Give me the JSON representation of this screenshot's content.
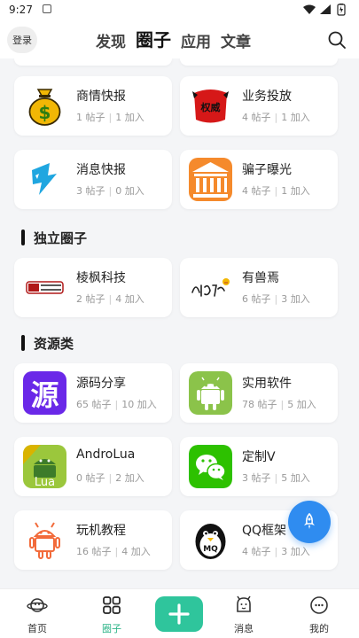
{
  "status_bar": {
    "time": "9:27"
  },
  "header": {
    "login_label": "登录",
    "tabs": [
      {
        "label": "发现",
        "active": false
      },
      {
        "label": "圈子",
        "active": true
      },
      {
        "label": "应用",
        "active": false
      },
      {
        "label": "文章",
        "active": false
      }
    ]
  },
  "circles_top": [
    {
      "name": "商情快报",
      "posts": "1 帖子",
      "members": "1 加入",
      "icon": "money-bag-icon"
    },
    {
      "name": "业务投放",
      "posts": "4 帖子",
      "members": "1 加入",
      "icon": "red-banner-icon"
    },
    {
      "name": "消息快报",
      "posts": "3 帖子",
      "members": "0 加入",
      "icon": "lightning-icon"
    },
    {
      "name": "骗子曝光",
      "posts": "4 帖子",
      "members": "1 加入",
      "icon": "bank-building-icon"
    }
  ],
  "sections": [
    {
      "title": "独立圈子",
      "items": [
        {
          "name": "棱枫科技",
          "posts": "2 帖子",
          "members": "4 加入",
          "icon": "lengfeng-logo-icon"
        },
        {
          "name": "有兽焉",
          "posts": "6 帖子",
          "members": "3 加入",
          "icon": "youshouyan-logo-icon"
        }
      ]
    },
    {
      "title": "资源类",
      "items": [
        {
          "name": "源码分享",
          "posts": "65 帖子",
          "members": "10 加入",
          "icon": "source-char-icon",
          "icon_char": "源"
        },
        {
          "name": "实用软件",
          "posts": "78 帖子",
          "members": "5 加入",
          "icon": "android-robot-icon"
        },
        {
          "name": "AndroLua",
          "posts": "0 帖子",
          "members": "2 加入",
          "icon": "androlua-icon",
          "icon_text": "Lua"
        },
        {
          "name": "定制V",
          "posts": "3 帖子",
          "members": "5 加入",
          "icon": "wechat-icon"
        },
        {
          "name": "玩机教程",
          "posts": "16 帖子",
          "members": "4 加入",
          "icon": "android-robot-outline-icon"
        },
        {
          "name": "QQ框架",
          "posts": "4 帖子",
          "members": "3 加入",
          "icon": "qq-penguin-icon",
          "icon_text": "MQ"
        }
      ]
    }
  ],
  "bottom_nav": {
    "items": [
      {
        "label": "首页",
        "icon": "planet-icon",
        "active": false
      },
      {
        "label": "圈子",
        "icon": "grid-icon",
        "active": true
      },
      {
        "label": "",
        "icon": "plus-icon",
        "active": false
      },
      {
        "label": "消息",
        "icon": "bell-face-icon",
        "active": false
      },
      {
        "label": "我的",
        "icon": "chat-bubble-icon",
        "active": false
      }
    ]
  },
  "colors": {
    "accent_green": "#2fc59c",
    "active_nav_text": "#2fb589",
    "fab_blue": "#2f8cf0",
    "source_purple": "#6a28e8",
    "android_green": "#8bc34a",
    "wechat_green": "#2dc100",
    "money_gold": "#f2b705",
    "banner_red": "#d61818",
    "bank_orange": "#f58a2c",
    "lightning_blue": "#1fa6e0"
  }
}
